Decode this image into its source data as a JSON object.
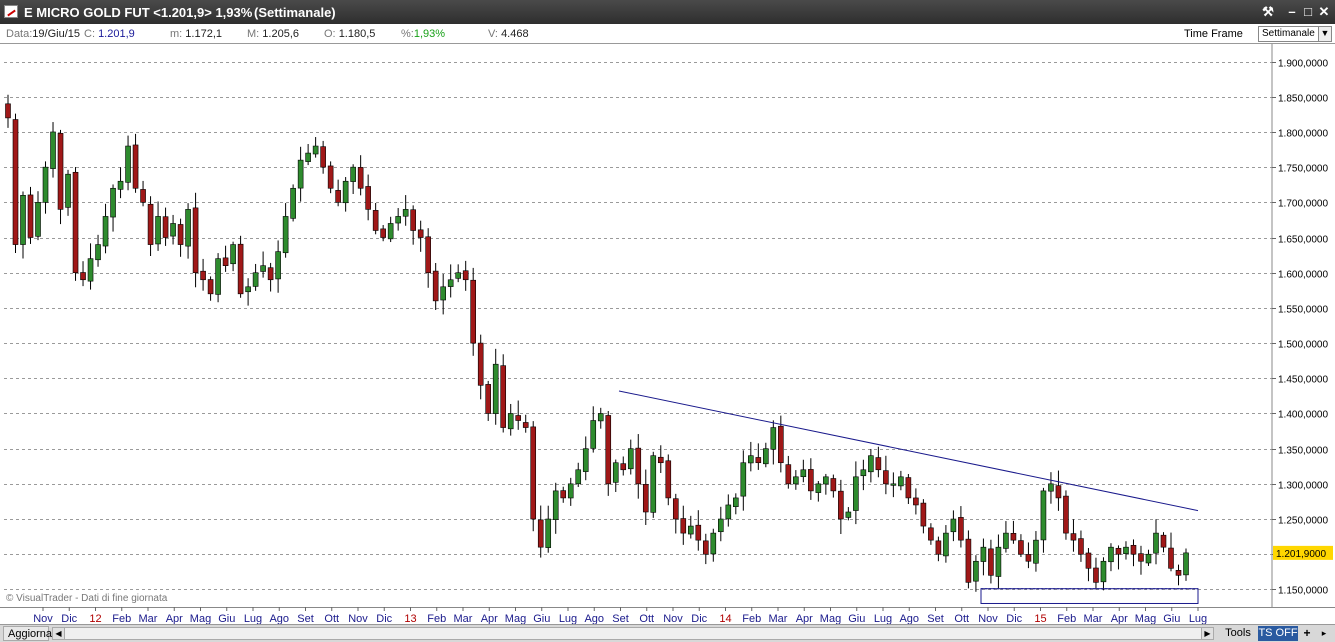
{
  "window": {
    "title": "E MICRO GOLD FUT <1.201,9> 1,93%",
    "period": "(Settimanale)"
  },
  "infobar": {
    "date_label": "Data:",
    "date_value": "19/Giu/15",
    "close_label": "C:",
    "close_value": "1.201,9",
    "min_label": "m:",
    "min_value": "1.172,1",
    "max_label": "M:",
    "max_value": "1.205,6",
    "open_label": "O:",
    "open_value": "1.180,5",
    "pct_label": "%:",
    "pct_value": "1,93%",
    "vol_label": "V:",
    "vol_value": "4.468",
    "timeframe_label": "Time Frame",
    "timeframe_value": "Settimanale"
  },
  "watermark": "© VisualTrader - Dati di fine giornata",
  "bottombar": {
    "refresh_label": "Aggiorna",
    "tools_label": "Tools",
    "tsoff_label": "TS OFF",
    "plus_label": "+"
  },
  "colors": {
    "up": "#2e8b2e",
    "down": "#a01818",
    "trendline": "#1a1a8c",
    "last_price_bg": "#ffd700",
    "xlabel_month": "#1a1a8c",
    "xlabel_year": "#b00000"
  },
  "chart_data": {
    "type": "candlestick",
    "title": "E MICRO GOLD FUT",
    "ylim": [
      1125000,
      1925000
    ],
    "yticks": [
      "1.150,0000",
      "1.200,0000",
      "1.250,0000",
      "1.300,0000",
      "1.350,0000",
      "1.400,0000",
      "1.450,0000",
      "1.500,0000",
      "1.550,0000",
      "1.600,0000",
      "1.650,0000",
      "1.700,0000",
      "1.750,0000",
      "1.800,0000",
      "1.850,0000",
      "1.900,0000"
    ],
    "last_price_label": "1.201,9000",
    "xticks": [
      {
        "label": "Nov",
        "year": false
      },
      {
        "label": "Dic",
        "year": false
      },
      {
        "label": "12",
        "year": true
      },
      {
        "label": "Feb",
        "year": false
      },
      {
        "label": "Mar",
        "year": false
      },
      {
        "label": "Apr",
        "year": false
      },
      {
        "label": "Mag",
        "year": false
      },
      {
        "label": "Giu",
        "year": false
      },
      {
        "label": "Lug",
        "year": false
      },
      {
        "label": "Ago",
        "year": false
      },
      {
        "label": "Set",
        "year": false
      },
      {
        "label": "Ott",
        "year": false
      },
      {
        "label": "Nov",
        "year": false
      },
      {
        "label": "Dic",
        "year": false
      },
      {
        "label": "13",
        "year": true
      },
      {
        "label": "Feb",
        "year": false
      },
      {
        "label": "Mar",
        "year": false
      },
      {
        "label": "Apr",
        "year": false
      },
      {
        "label": "Mag",
        "year": false
      },
      {
        "label": "Giu",
        "year": false
      },
      {
        "label": "Lug",
        "year": false
      },
      {
        "label": "Ago",
        "year": false
      },
      {
        "label": "Set",
        "year": false
      },
      {
        "label": "Ott",
        "year": false
      },
      {
        "label": "Nov",
        "year": false
      },
      {
        "label": "Dic",
        "year": false
      },
      {
        "label": "14",
        "year": true
      },
      {
        "label": "Feb",
        "year": false
      },
      {
        "label": "Mar",
        "year": false
      },
      {
        "label": "Apr",
        "year": false
      },
      {
        "label": "Mag",
        "year": false
      },
      {
        "label": "Giu",
        "year": false
      },
      {
        "label": "Lug",
        "year": false
      },
      {
        "label": "Ago",
        "year": false
      },
      {
        "label": "Set",
        "year": false
      },
      {
        "label": "Ott",
        "year": false
      },
      {
        "label": "Nov",
        "year": false
      },
      {
        "label": "Dic",
        "year": false
      },
      {
        "label": "15",
        "year": true
      },
      {
        "label": "Feb",
        "year": false
      },
      {
        "label": "Mar",
        "year": false
      },
      {
        "label": "Apr",
        "year": false
      },
      {
        "label": "Mag",
        "year": false
      },
      {
        "label": "Giu",
        "year": false
      },
      {
        "label": "Lug",
        "year": false
      }
    ],
    "closes": [
      1820000,
      1640000,
      1710000,
      1650000,
      1700000,
      1750000,
      1800000,
      1690000,
      1740000,
      1600000,
      1590000,
      1620000,
      1640000,
      1680000,
      1720000,
      1730000,
      1780000,
      1720000,
      1700000,
      1640000,
      1680000,
      1650000,
      1670000,
      1640000,
      1690000,
      1600000,
      1590000,
      1570000,
      1620000,
      1610000,
      1640000,
      1570000,
      1580000,
      1600000,
      1610000,
      1590000,
      1630000,
      1680000,
      1720000,
      1760000,
      1770000,
      1780000,
      1750000,
      1720000,
      1700000,
      1730000,
      1750000,
      1720000,
      1690000,
      1660000,
      1650000,
      1670000,
      1680000,
      1690000,
      1660000,
      1650000,
      1600000,
      1560000,
      1580000,
      1590000,
      1600000,
      1590000,
      1500000,
      1440000,
      1400000,
      1470000,
      1380000,
      1400000,
      1390000,
      1380000,
      1250000,
      1210000,
      1250000,
      1290000,
      1280000,
      1300000,
      1320000,
      1350000,
      1390000,
      1400000,
      1300000,
      1330000,
      1320000,
      1350000,
      1300000,
      1260000,
      1340000,
      1330000,
      1280000,
      1250000,
      1230000,
      1240000,
      1220000,
      1200000,
      1230000,
      1250000,
      1270000,
      1280000,
      1330000,
      1340000,
      1330000,
      1350000,
      1380000,
      1330000,
      1300000,
      1310000,
      1320000,
      1290000,
      1300000,
      1310000,
      1290000,
      1250000,
      1260000,
      1310000,
      1320000,
      1340000,
      1320000,
      1300000,
      1300000,
      1310000,
      1280000,
      1270000,
      1240000,
      1220000,
      1200000,
      1230000,
      1250000,
      1220000,
      1160000,
      1190000,
      1210000,
      1170000,
      1210000,
      1230000,
      1220000,
      1200000,
      1190000,
      1220000,
      1290000,
      1300000,
      1280000,
      1230000,
      1220000,
      1200000,
      1180000,
      1160000,
      1190000,
      1210000,
      1200000,
      1210000,
      1200000,
      1190000,
      1200000,
      1230000,
      1210000,
      1180000,
      1170000,
      1201900
    ]
  }
}
